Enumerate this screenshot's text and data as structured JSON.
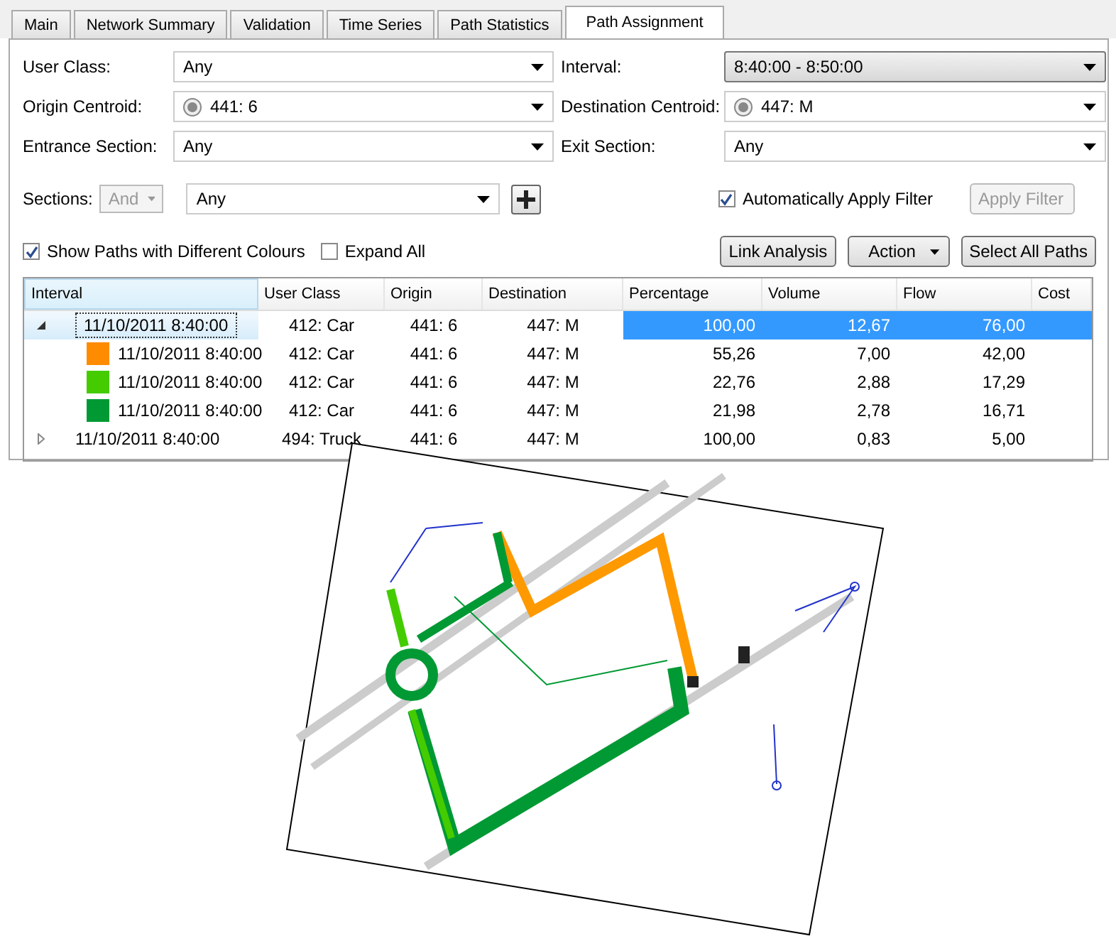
{
  "tabs": [
    {
      "label": "Main",
      "selected": false
    },
    {
      "label": "Network Summary",
      "selected": false
    },
    {
      "label": "Validation",
      "selected": false
    },
    {
      "label": "Time Series",
      "selected": false
    },
    {
      "label": "Path Statistics",
      "selected": false
    },
    {
      "label": "Path Assignment",
      "selected": true
    }
  ],
  "filters": [
    {
      "label": "User Class:",
      "value": "Any",
      "kind": "dropdown",
      "highlighted": false
    },
    {
      "label": "Interval:",
      "value": "8:40:00 - 8:50:00",
      "kind": "dropdown",
      "highlighted": true
    },
    {
      "label": "Origin Centroid:",
      "value": "441: 6",
      "kind": "centroid",
      "highlighted": false
    },
    {
      "label": "Destination Centroid:",
      "value": "447: M",
      "kind": "centroid",
      "highlighted": false
    },
    {
      "label": "Entrance Section:",
      "value": "Any",
      "kind": "dropdown",
      "highlighted": false
    },
    {
      "label": "Exit Section:",
      "value": "Any",
      "kind": "dropdown",
      "highlighted": false
    }
  ],
  "sections": {
    "label": "Sections:",
    "operator": "And",
    "operator_disabled": true,
    "value": "Any"
  },
  "auto_apply": {
    "label": "Automatically Apply Filter",
    "checked": true
  },
  "apply_button": {
    "label": "Apply Filter",
    "disabled": true
  },
  "options": [
    {
      "label": "Show Paths with Different Colours",
      "checked": true
    },
    {
      "label": "Expand All",
      "checked": false
    }
  ],
  "buttons": [
    {
      "label": "Link Analysis",
      "kind": "plain"
    },
    {
      "label": "Action",
      "kind": "menu"
    },
    {
      "label": "Select All Paths",
      "kind": "plain"
    }
  ],
  "table": {
    "columns": [
      "Interval",
      "User Class",
      "Origin",
      "Destination",
      "Percentage",
      "Volume",
      "Flow",
      "Cost"
    ],
    "rows": [
      {
        "cells": [
          "11/10/2011 8:40:00",
          "412: Car",
          "441: 6",
          "447: M",
          "100,00",
          "12,67",
          "76,00"
        ],
        "expanded": true,
        "selected": true,
        "children": [
          {
            "cells": [
              "11/10/2011 8:40:00",
              "412: Car",
              "441: 6",
              "447: M",
              "55,26",
              "7,00",
              "42,00"
            ],
            "color": "#ff8c00"
          },
          {
            "cells": [
              "11/10/2011 8:40:00",
              "412: Car",
              "441: 6",
              "447: M",
              "22,76",
              "2,88",
              "17,29"
            ],
            "color": "#44cc00"
          },
          {
            "cells": [
              "11/10/2011 8:40:00",
              "412: Car",
              "441: 6",
              "447: M",
              "21,98",
              "2,78",
              "16,71"
            ],
            "color": "#009933"
          }
        ]
      },
      {
        "cells": [
          "11/10/2011 8:40:00",
          "494: Truck",
          "441: 6",
          "447: M",
          "100,00",
          "0,83",
          "5,00"
        ],
        "expanded": false,
        "selected": false,
        "children": []
      }
    ]
  }
}
